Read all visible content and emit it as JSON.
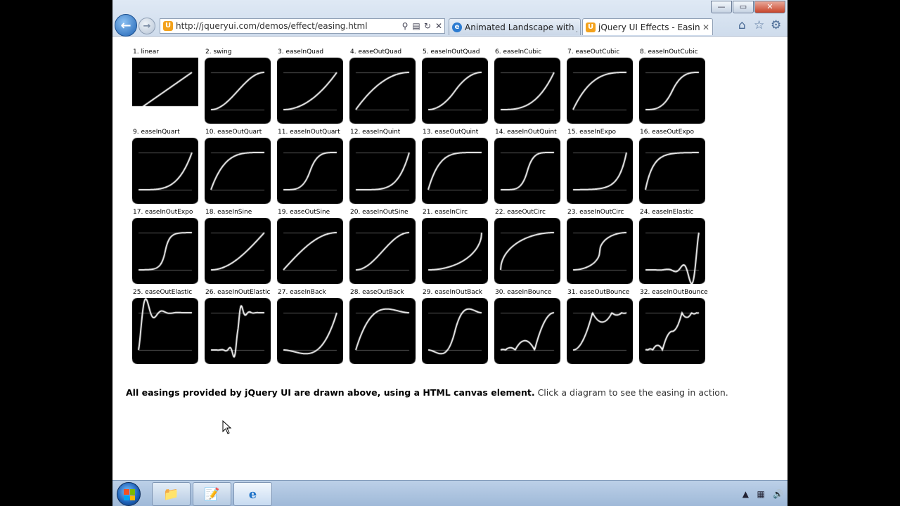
{
  "browser": {
    "url": "http://jqueryui.com/demos/effect/easing.html",
    "tabs": [
      {
        "label": "Animated Landscape with jQu..."
      },
      {
        "label": "jQuery UI Effects - Easing d..."
      }
    ],
    "window_buttons": {
      "minimize": "—",
      "maximize": "▭",
      "close": "✕"
    }
  },
  "icons": {
    "back": "back-arrow-icon",
    "forward": "forward-arrow-icon",
    "home": "home-icon",
    "favorites": "star-icon",
    "tools": "gear-icon"
  },
  "easings": [
    "1. linear",
    "2. swing",
    "3. easeInQuad",
    "4. easeOutQuad",
    "5. easeInOutQuad",
    "6. easeInCubic",
    "7. easeOutCubic",
    "8. easeInOutCubic",
    "9. easeInQuart",
    "10. easeOutQuart",
    "11. easeInOutQuart",
    "12. easeInQuint",
    "13. easeOutQuint",
    "14. easeInOutQuint",
    "15. easeInExpo",
    "16. easeOutExpo",
    "17. easeInOutExpo",
    "18. easeInSine",
    "19. easeOutSine",
    "20. easeInOutSine",
    "21. easeInCirc",
    "22. easeOutCirc",
    "23. easeInOutCirc",
    "24. easeInElastic",
    "25. easeOutElastic",
    "26. easeInOutElastic",
    "27. easeInBack",
    "28. easeOutBack",
    "29. easeInOutBack",
    "30. easeInBounce",
    "31. easeOutBounce",
    "32. easeInOutBounce"
  ],
  "footer": {
    "bold": "All easings provided by jQuery UI are drawn above, using a HTML canvas element.",
    "normal": " Click a diagram to see the easing in action."
  },
  "colors": {
    "canvas_bg": "#000000",
    "curve": "#ffffff",
    "guide": "#555555"
  }
}
